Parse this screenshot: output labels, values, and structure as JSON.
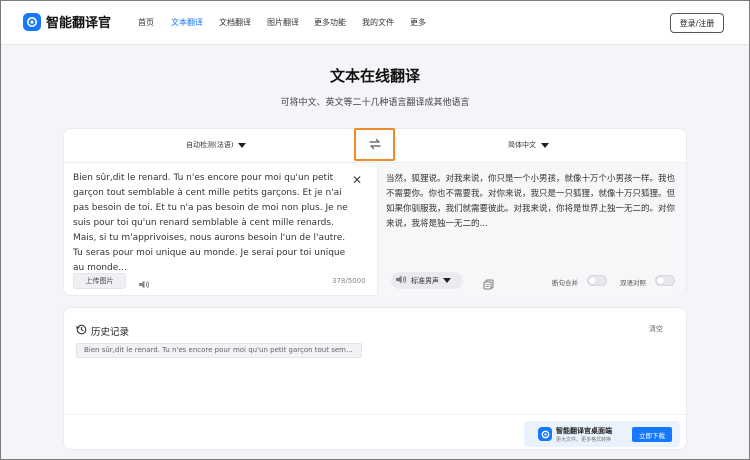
{
  "header": {
    "logo_text": "智能翻译官",
    "nav": [
      {
        "label": "首页",
        "active": false
      },
      {
        "label": "文本翻译",
        "active": true
      },
      {
        "label": "文档翻译",
        "active": false
      },
      {
        "label": "图片翻译",
        "active": false
      },
      {
        "label": "更多功能",
        "active": false
      },
      {
        "label": "我的文件",
        "active": false
      },
      {
        "label": "更多",
        "active": false
      }
    ],
    "login_label": "登录/注册"
  },
  "hero": {
    "title": "文本在线翻译",
    "subtitle": "可将中文、英文等二十几种语言翻译成其他语言"
  },
  "translator": {
    "source_lang": "自动检测(法语)",
    "target_lang": "简体中文",
    "source_text": "Bien sûr,dit le renard. Tu n'es encore pour moi qu'un petit garçon tout semblable à cent mille petits garçons. Et je n'ai pas besoin de toi. Et tu n'a pas besoin de moi non plus. Je ne suis pour toi qu'un renard semblable à cent mille renards. Mais, si tu m'apprivoises, nous aurons besoin l'un de l'autre. Tu seras pour moi unique au monde. Je serai pour toi unique au monde...",
    "upload_label": "上传图片",
    "char_count": "378/5000",
    "target_text": "当然，狐狸说。对我来说，你只是一个小男孩，就像十万个小男孩一样。我也不需要你。你也不需要我。对你来说，我只是一只狐狸，就像十万只狐狸。但如果你驯服我，我们就需要彼此。对我来说，你将是世界上独一无二的。对你来说，我将是独一无二的...",
    "voice_label": "标准男声",
    "toggle_merge_label": "断句合并",
    "toggle_bilingual_label": "双语对照"
  },
  "history": {
    "title": "历史记录",
    "clear_label": "清空",
    "items": [
      "Bien sûr,dit le renard. Tu n'es encore pour moi qu'un petit garçon tout sem..."
    ]
  },
  "download": {
    "title": "智能翻译官桌面端",
    "subtitle": "更大文件，更多格式转换",
    "button_label": "立即下载"
  },
  "colors": {
    "accent": "#1677ff",
    "swap_highlight": "#f08a2a"
  }
}
